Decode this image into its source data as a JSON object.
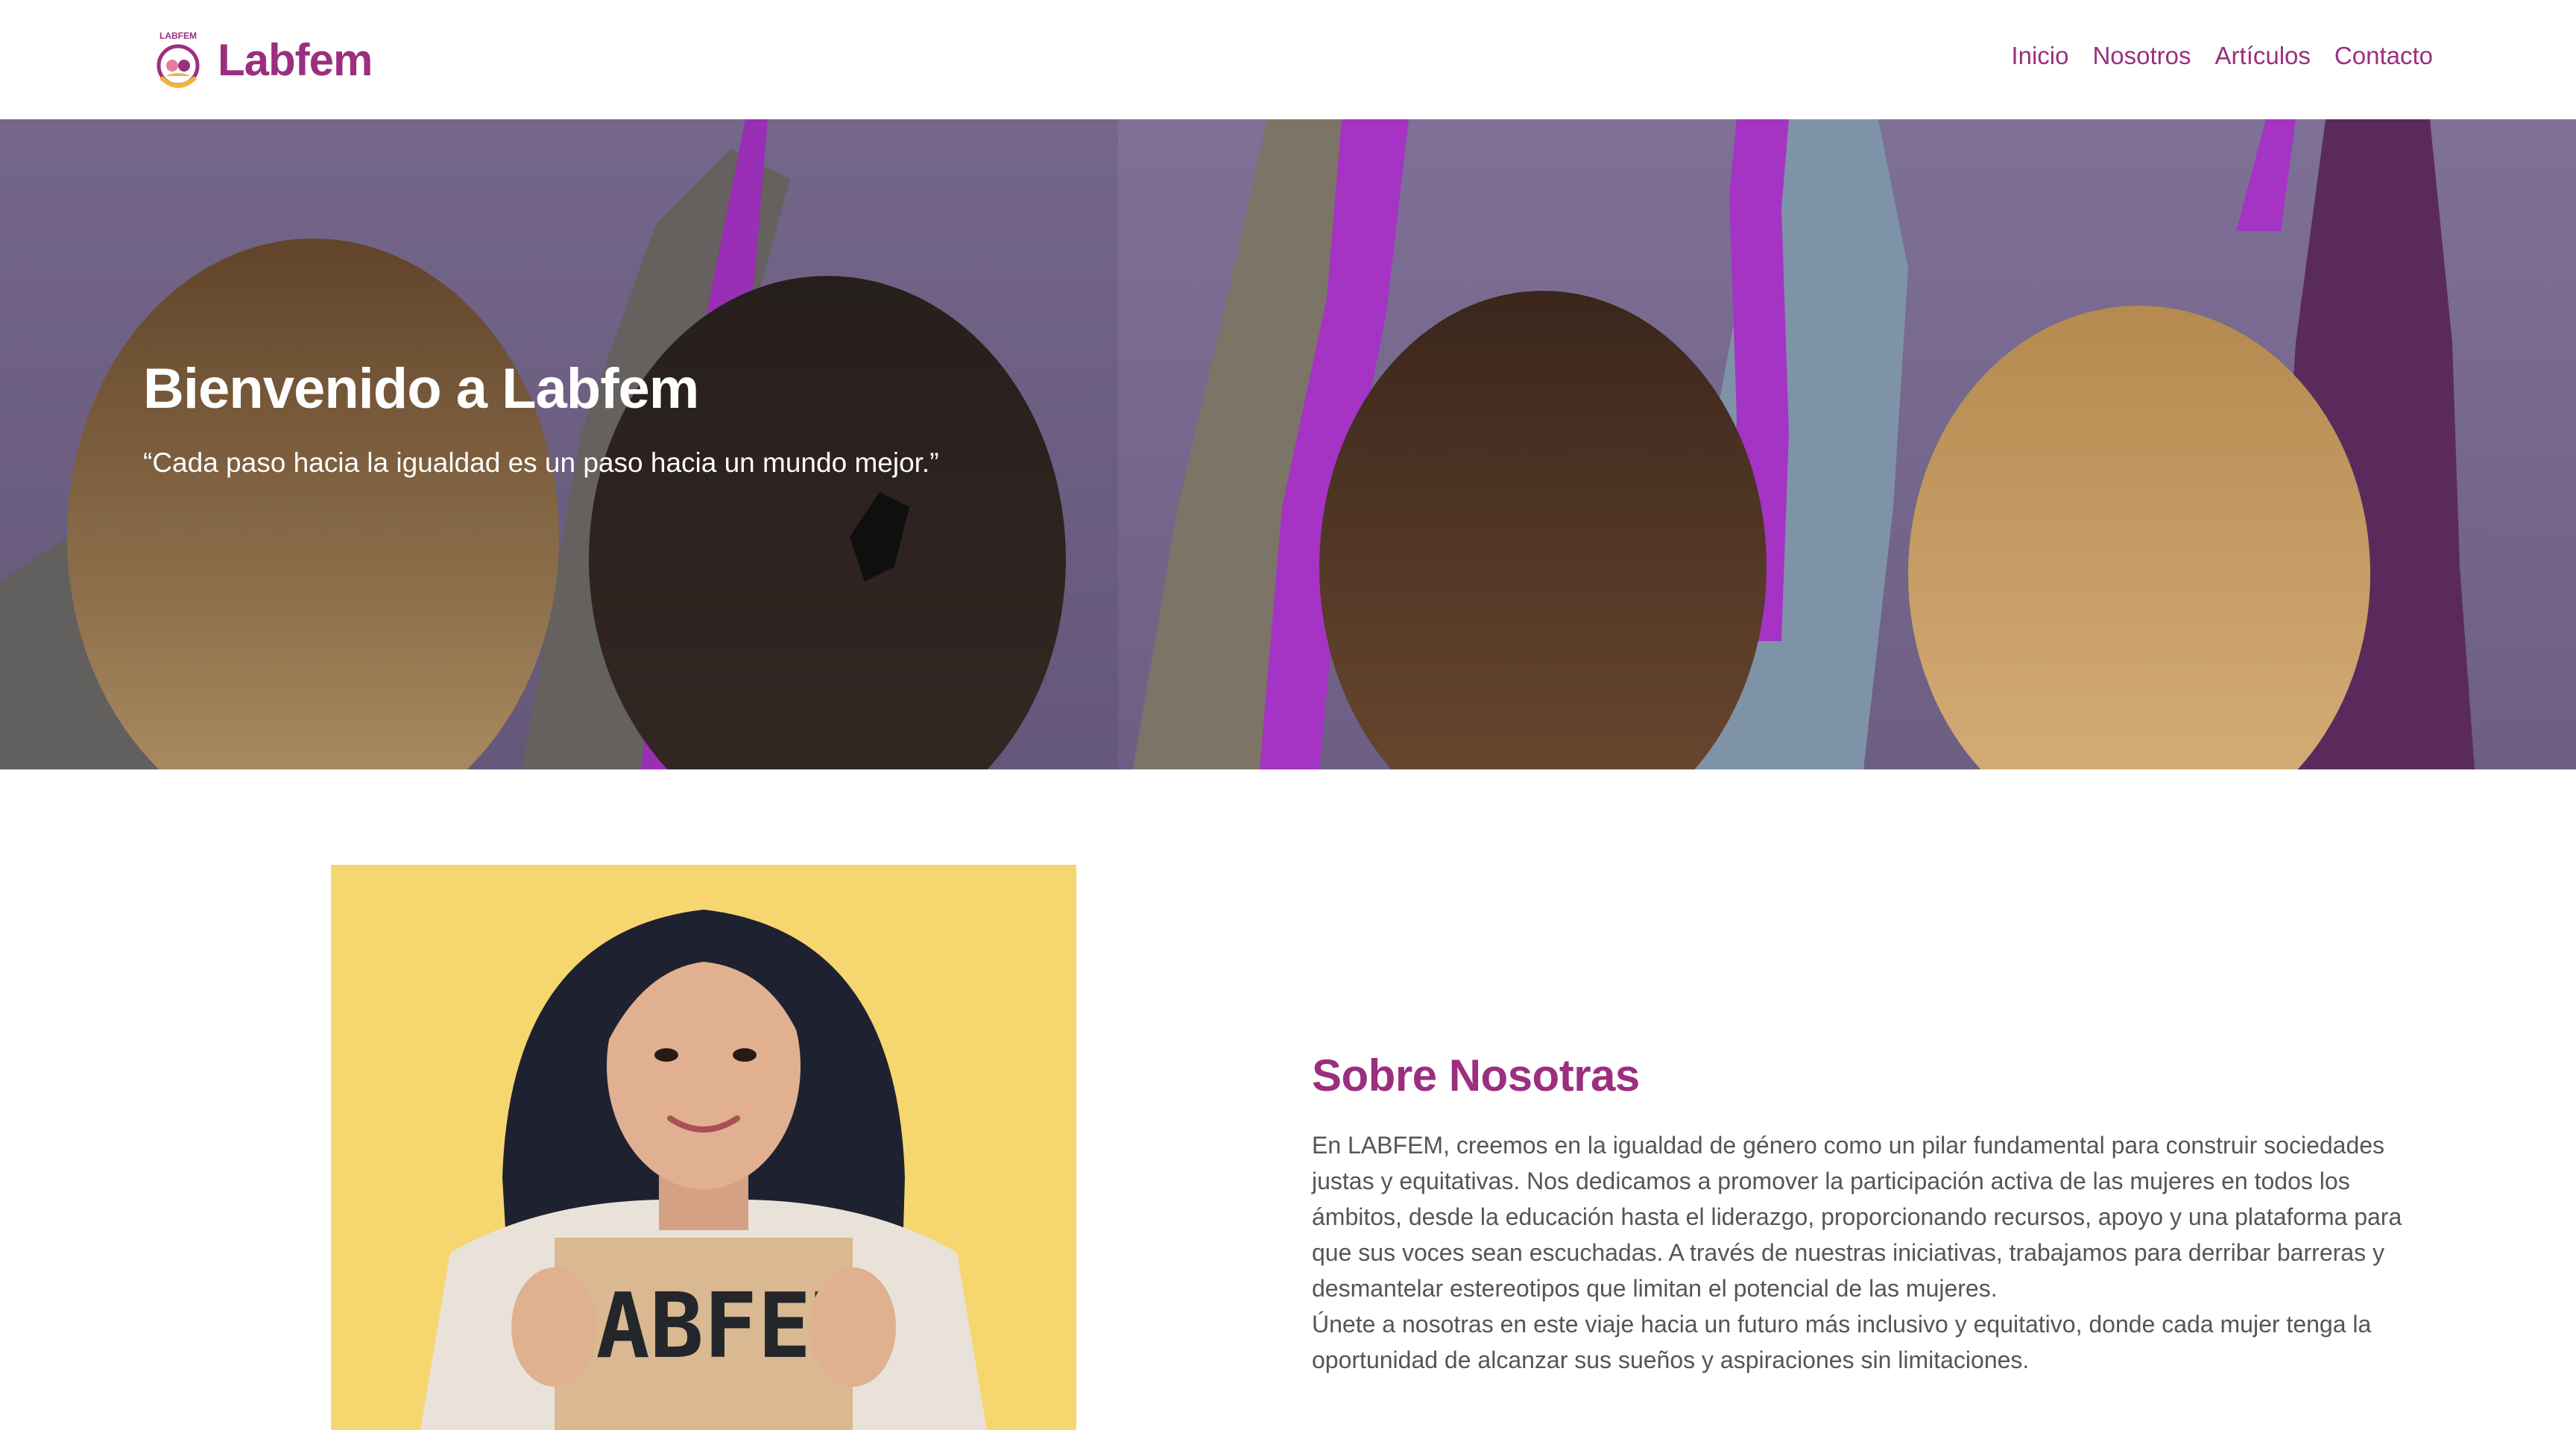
{
  "brand": {
    "logo_text": "LABFEM",
    "name": "Labfem"
  },
  "nav": {
    "items": [
      "Inicio",
      "Nosotros",
      "Artículos",
      "Contacto"
    ]
  },
  "hero": {
    "title": "Bienvenido a Labfem",
    "quote": "“Cada paso hacia la igualdad es un paso hacia un mundo mejor.”"
  },
  "about": {
    "sign_text": "LABFEM",
    "title": "Sobre Nosotras",
    "paragraph_1": "En LABFEM, creemos en la igualdad de género como un pilar fundamental para construir sociedades justas y equitativas. Nos dedicamos a promover la participación activa de las mujeres en todos los ámbitos, desde la educación hasta el liderazgo, proporcionando recursos, apoyo y una plataforma para que sus voces sean escuchadas. A través de nuestras iniciativas, trabajamos para derribar barreras y desmantelar estereotipos que limitan el potencial de las mujeres.",
    "paragraph_2": "Únete a nosotras en este viaje hacia un futuro más inclusivo y equitativo, donde cada mujer tenga la oportunidad de alcanzar sus sueños y aspiraciones sin limitaciones."
  },
  "colors": {
    "brand": "#9b2f7f",
    "hero_bg": "#7a6c90",
    "ribbon": "#a533c4",
    "about_bg": "#f6d66f"
  }
}
